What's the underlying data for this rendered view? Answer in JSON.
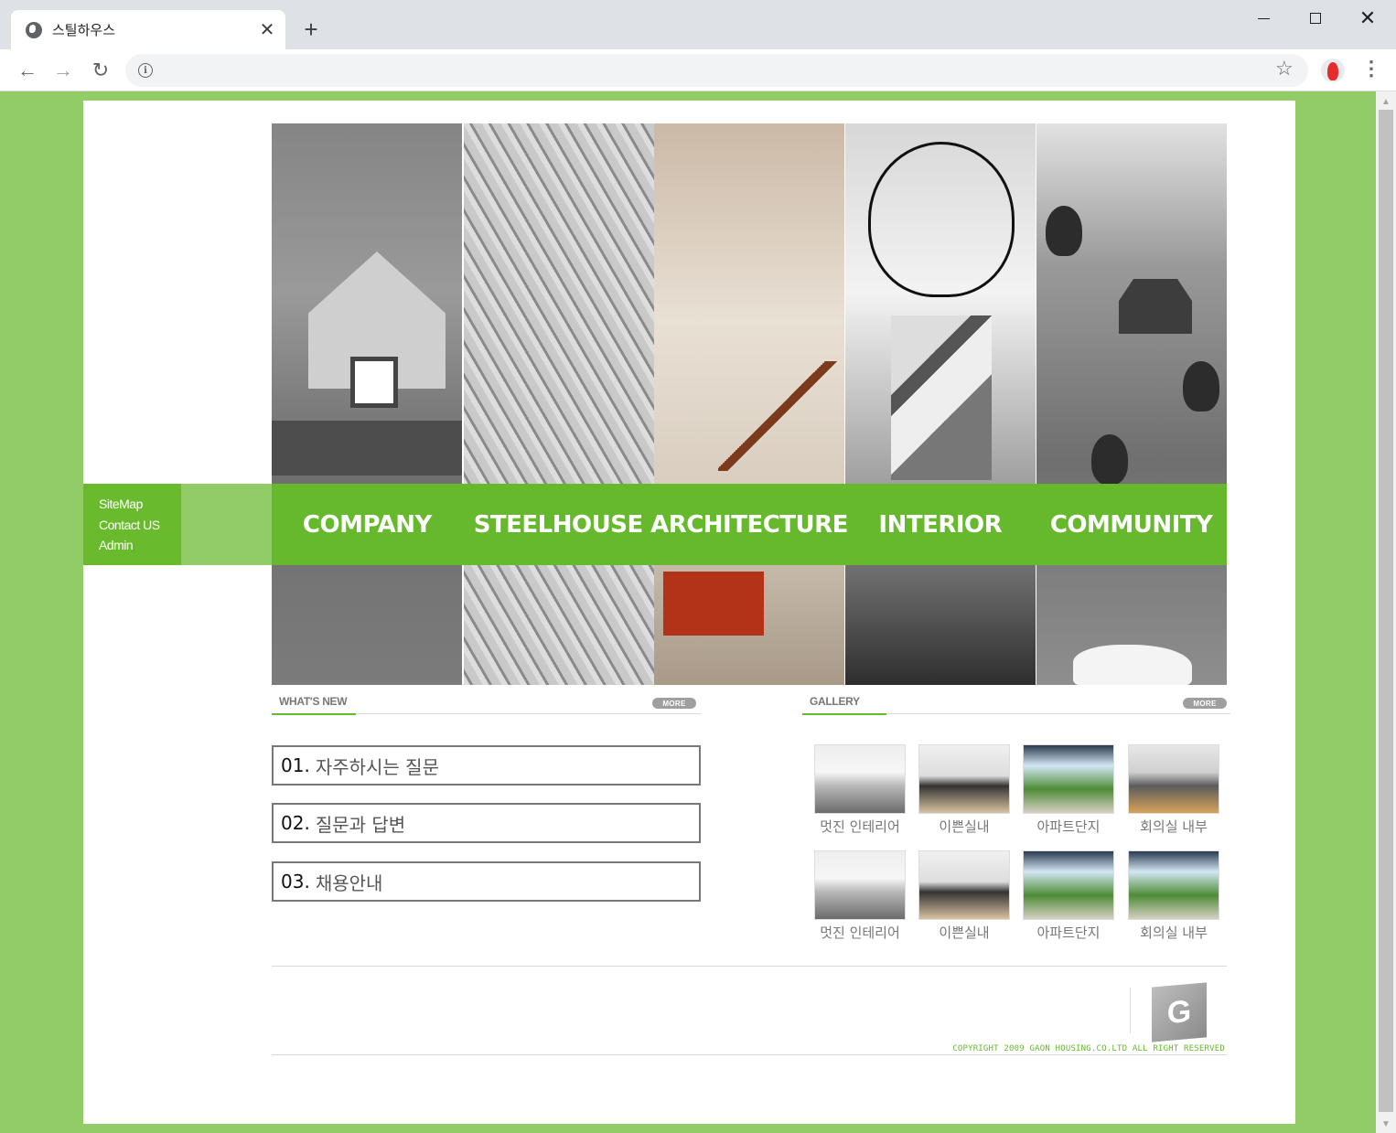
{
  "browser": {
    "tab_title": "스틸하우스",
    "tab_close": "✕",
    "new_tab": "+",
    "url": "",
    "icons": [
      "globe-icon",
      "close-icon",
      "plus-icon",
      "back-icon",
      "forward-icon",
      "reload-icon",
      "info-icon",
      "star-icon",
      "avatar",
      "menu-icon"
    ]
  },
  "sidebar": {
    "links": [
      "SiteMap",
      "Contact US",
      "Admin"
    ]
  },
  "nav": {
    "items": [
      "COMPANY",
      "STEELHOUSE",
      "ARCHITECTURE",
      "INTERIOR",
      "COMMUNITY"
    ]
  },
  "whats_new": {
    "title": "WHAT'S NEW",
    "more": "MORE",
    "items": [
      {
        "num": "01.",
        "text": "자주하시는 질문"
      },
      {
        "num": "02.",
        "text": "질문과 답변"
      },
      {
        "num": "03.",
        "text": "채용안내"
      }
    ]
  },
  "gallery": {
    "title": "GALLERY",
    "more": "MORE",
    "items": [
      {
        "caption": "멋진 인테리어",
        "thumb": "office"
      },
      {
        "caption": "이쁜실내",
        "thumb": "desk"
      },
      {
        "caption": "아파트단지",
        "thumb": "garden"
      },
      {
        "caption": "회의실 내부",
        "thumb": "meet"
      },
      {
        "caption": "멋진 인테리어",
        "thumb": "office"
      },
      {
        "caption": "이쁜실내",
        "thumb": "desk"
      },
      {
        "caption": "아파트단지",
        "thumb": "garden"
      },
      {
        "caption": "회의실 내부",
        "thumb": "garden"
      }
    ]
  },
  "footer": {
    "logo_letter": "G",
    "copyright": "COPYRIGHT 2009 GAON HOUSING.CO.LTD ALL RIGHT RESERVED"
  },
  "colors": {
    "page_bg": "#92cc66",
    "nav_green": "#66b92c",
    "sidebar_green": "#6aba2e"
  }
}
